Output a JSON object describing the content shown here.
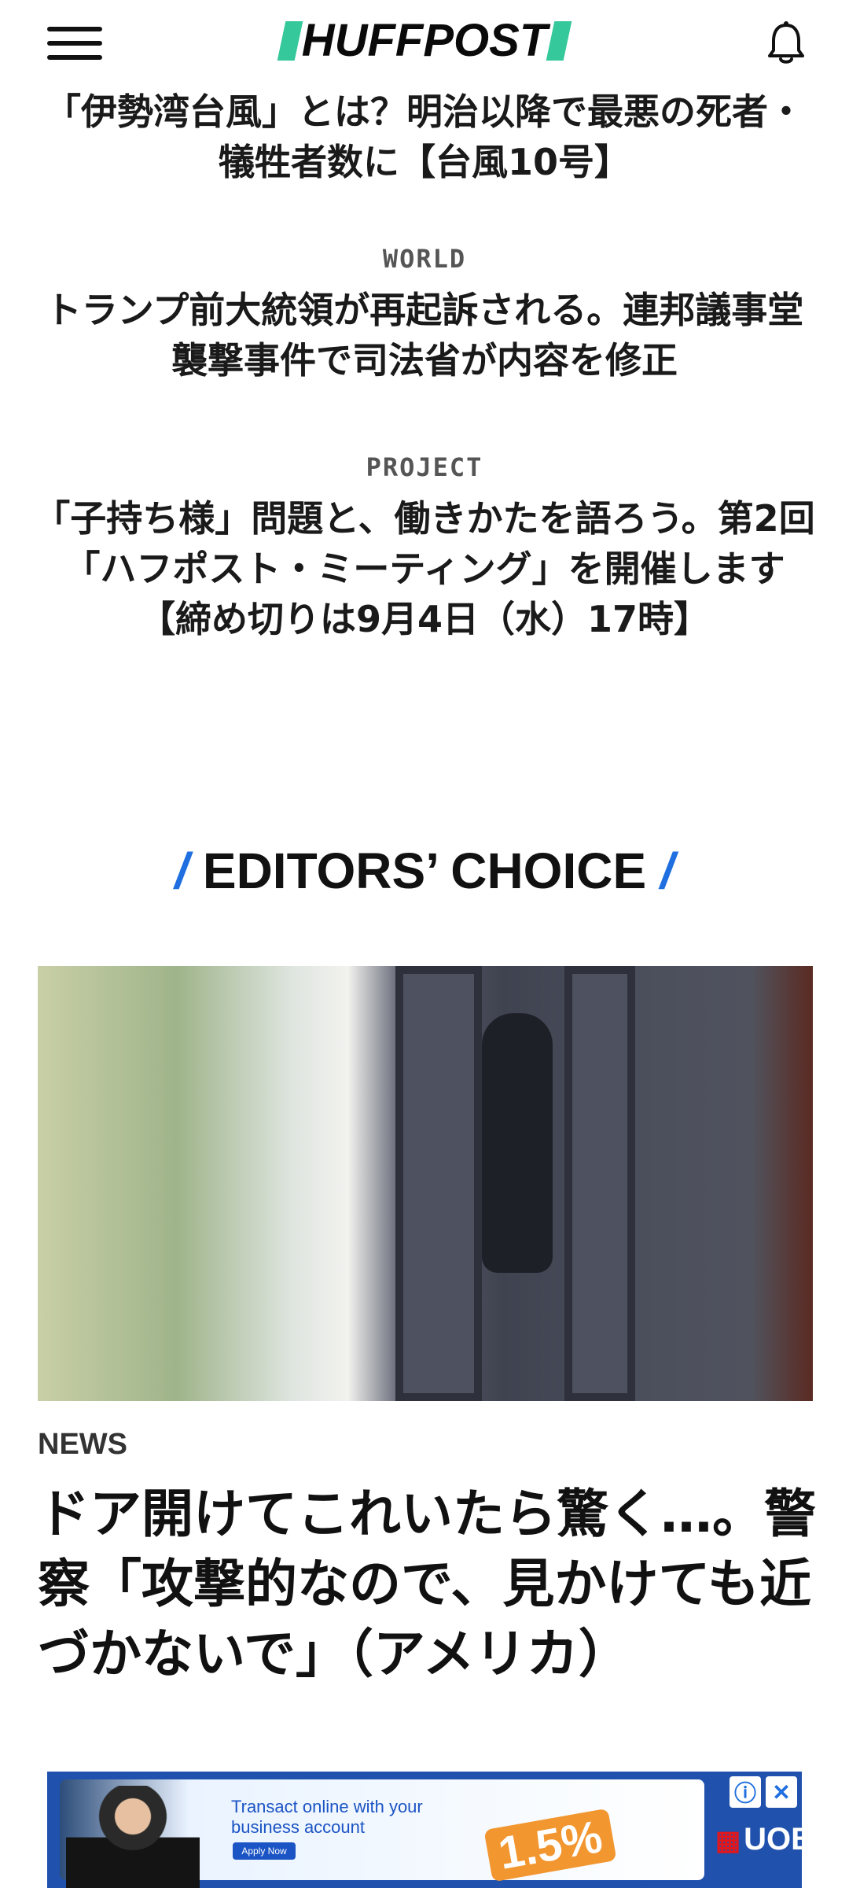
{
  "header": {
    "logo": "HUFFPOST",
    "menu_icon": "hamburger-menu-icon",
    "bell_icon": "notification-bell-icon"
  },
  "stories": [
    {
      "kicker": "",
      "headline": "「伊勢湾台風」とは？明治以降で最悪の死者・犠牲者数に【台風10号】"
    },
    {
      "kicker": "WORLD",
      "headline": "トランプ前大統領が再起訴される。連邦議事堂襲撃事件で司法省が内容を修正"
    },
    {
      "kicker": "PROJECT",
      "headline": "「子持ち様」問題と、働きかたを語ろう。第2回「ハフポスト・ミーティング」を開催します【締め切りは9月4日（水）17時】"
    }
  ],
  "editors_choice": {
    "title": "EDITORS’ CHOICE",
    "article": {
      "kicker": "NEWS",
      "headline": "ドア開けてこれいたら驚く…。警察「攻撃的なので、見かけても近づかないで」（アメリカ）"
    }
  },
  "ad": {
    "text": "Transact online with your business account",
    "apply": "Apply Now",
    "rate": "1.5%",
    "brand": "UOB",
    "info_icon": "ⓘ",
    "close_icon": "✕"
  },
  "colors": {
    "logo_accent": "#35c89a",
    "section_slash": "#1f6fe0",
    "ad_background": "#1f51ad"
  }
}
